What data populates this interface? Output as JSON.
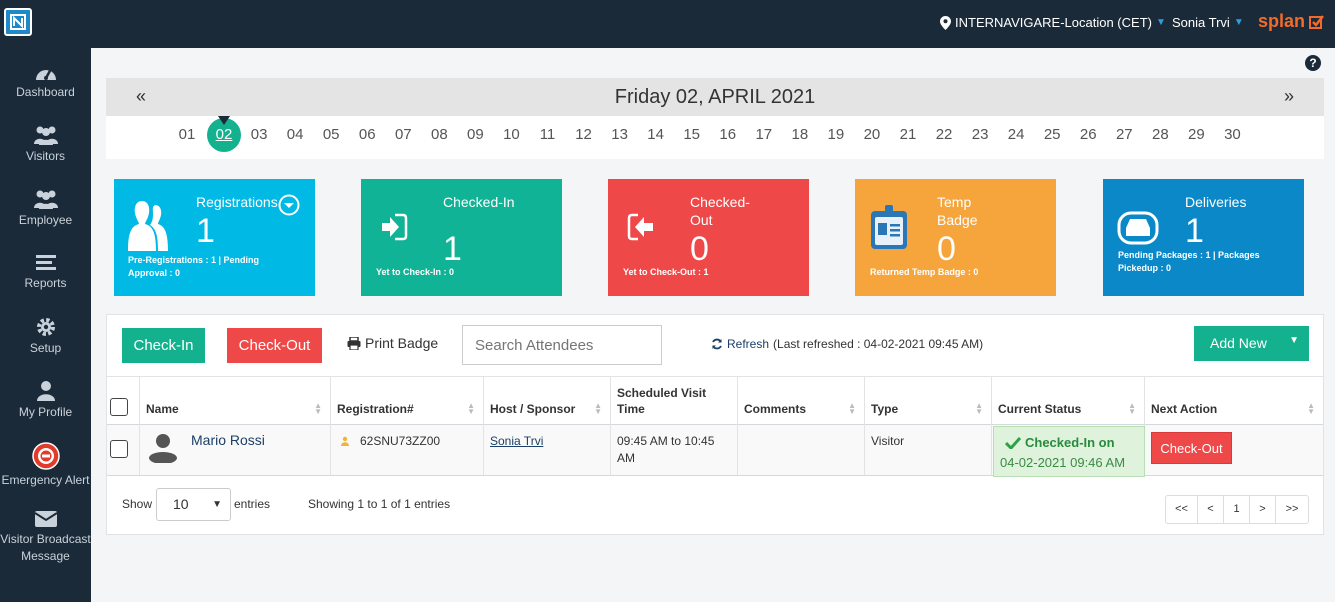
{
  "header": {
    "location": "INTERNAVIGARE-Location (CET)",
    "user": "Sonia Trvi",
    "brand": "splan",
    "colors": {
      "bar": "#1b2a38",
      "brand": "#f26b2a",
      "accent": "#2e9fe6"
    }
  },
  "sidebar": {
    "items": [
      {
        "label": "Dashboard",
        "icon": "dashboard-icon"
      },
      {
        "label": "Visitors",
        "icon": "visitors-icon"
      },
      {
        "label": "Employee",
        "icon": "employee-icon"
      },
      {
        "label": "Reports",
        "icon": "reports-icon"
      },
      {
        "label": "Setup",
        "icon": "gear-icon"
      },
      {
        "label": "My Profile",
        "icon": "user-icon"
      },
      {
        "label": "Emergency Alert",
        "icon": "alarm-icon"
      },
      {
        "label": "Visitor Broadcast Message",
        "icon": "envelope-icon"
      }
    ]
  },
  "calendar": {
    "prev": "«",
    "next": "»",
    "title": "Friday 02, APRIL 2021",
    "days": [
      "01",
      "02",
      "03",
      "04",
      "05",
      "06",
      "07",
      "08",
      "09",
      "10",
      "11",
      "12",
      "13",
      "14",
      "15",
      "16",
      "17",
      "18",
      "19",
      "20",
      "21",
      "22",
      "23",
      "24",
      "25",
      "26",
      "27",
      "28",
      "29",
      "30"
    ],
    "selected_day": "02"
  },
  "cards": {
    "registrations": {
      "title": "Registrations",
      "count": "1",
      "sub": "Pre-Registrations : 1 | Pending Approval : 0",
      "color": "#00b9e5"
    },
    "checked_in": {
      "title": "Checked-In",
      "count": "1",
      "sub": "Yet to Check-In : 0",
      "color": "#10b395"
    },
    "checked_out": {
      "title": "Checked-Out",
      "count": "0",
      "sub": "Yet to Check-Out : 1",
      "color": "#ee4848"
    },
    "temp_badge": {
      "title": "Temp Badge",
      "count": "0",
      "sub": "Returned Temp Badge : 0",
      "color": "#f6a53c"
    },
    "deliveries": {
      "title": "Deliveries",
      "count": "1",
      "sub": "Pending Packages : 1 | Packages Pickedup : 0",
      "color": "#0a88c8"
    }
  },
  "toolbar": {
    "checkin": "Check-In",
    "checkout": "Check-Out",
    "print_badge": "Print Badge",
    "search_placeholder": "Search Attendees",
    "refresh": "Refresh",
    "last_refreshed": "(Last refreshed : 04-02-2021 09:45 AM)",
    "add_new": "Add New"
  },
  "table": {
    "columns": [
      "Name",
      "Registration#",
      "Host / Sponsor",
      "Scheduled Visit Time",
      "Comments",
      "Type",
      "Current Status",
      "Next Action"
    ],
    "rows": [
      {
        "name": "Mario Rossi",
        "registration": "62SNU73ZZ00",
        "host": "Sonia Trvi",
        "time": "09:45 AM to 10:45 AM",
        "comments": "",
        "type": "Visitor",
        "status": "Checked-In on",
        "status_time": "04-02-2021 09:46 AM",
        "next_action": "Check-Out"
      }
    ]
  },
  "footer": {
    "show": "Show",
    "entries_value": "10",
    "entries": "entries",
    "info": "Showing 1 to 1 of 1 entries",
    "pager": [
      "<<",
      "<",
      "1",
      ">",
      ">>"
    ]
  }
}
